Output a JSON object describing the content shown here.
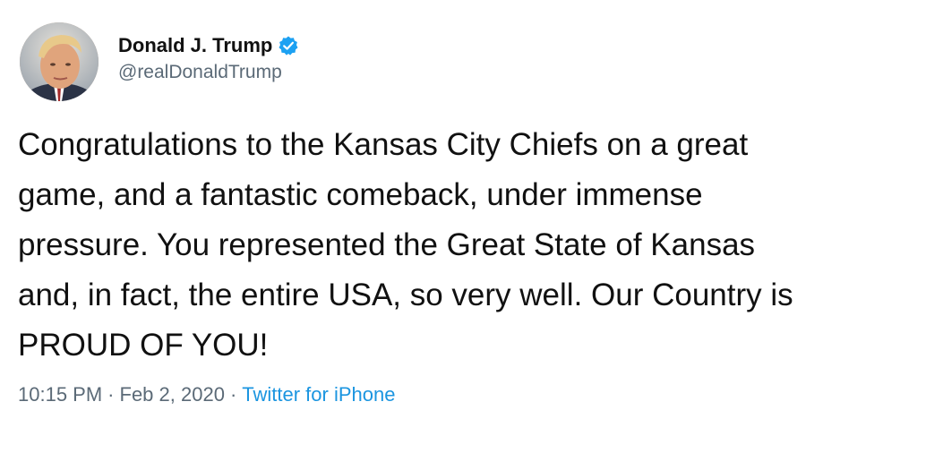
{
  "tweet": {
    "author": {
      "display_name": "Donald J. Trump",
      "handle": "@realDonaldTrump",
      "verified": true,
      "verified_icon": "verified-badge-icon",
      "avatar_icon": "profile-photo"
    },
    "text": "Congratulations to the Kansas City Chiefs on a great\ngame, and a fantastic comeback, under immense\npressure. You represented the Great State of Kansas\nand, in fact, the entire USA, so very well. Our Country is\nPROUD OF YOU!",
    "time": "10:15 PM",
    "separator": "·",
    "date": "Feb 2, 2020",
    "source": "Twitter for iPhone"
  },
  "colors": {
    "text": "#111111",
    "secondary_text": "#5b6a77",
    "link": "#1b95e0",
    "verified_badge": "#1da1f2",
    "background": "#ffffff"
  }
}
